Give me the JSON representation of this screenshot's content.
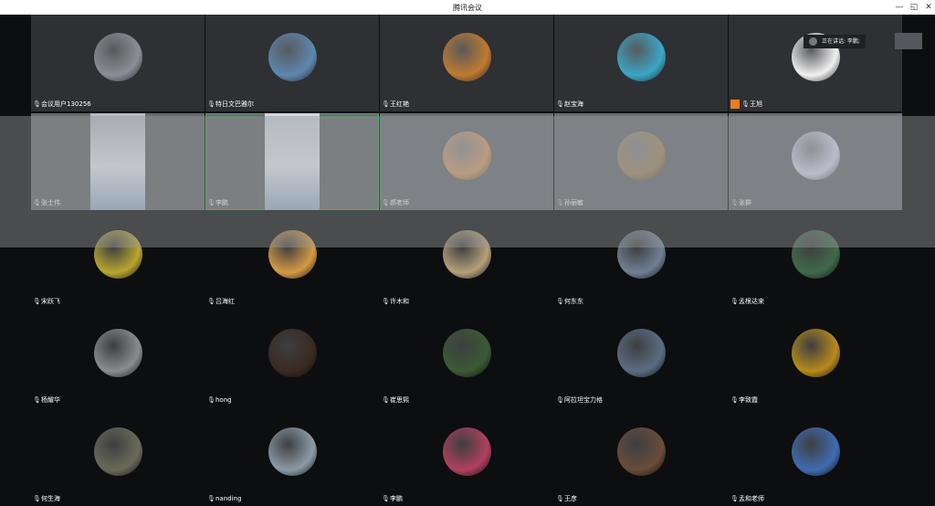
{
  "window": {
    "title": "腾讯会议",
    "minimize": "—",
    "restore": "◱",
    "close": "✕"
  },
  "speaking_indicator": {
    "label": "正在讲话: 李鹏;"
  },
  "participants": [
    {
      "name": "会议用户130256",
      "color": "#8a8f96",
      "mic": true
    },
    {
      "name": "特日文巴雅尔",
      "color": "#5d87ae",
      "mic": true
    },
    {
      "name": "王红艳",
      "color": "#c07a2e",
      "mic": true
    },
    {
      "name": "赵宝海",
      "color": "#3aa6c6",
      "mic": true
    },
    {
      "name": "王旭",
      "color": "#f0f0f0",
      "mic": true,
      "host": true
    },
    {
      "name": "张士伟",
      "color": "#b5b9c2",
      "mic": true,
      "video": true
    },
    {
      "name": "李鹏",
      "color": "#cfd6df",
      "mic": true,
      "video": true,
      "active": true
    },
    {
      "name": "郝老师",
      "color": "#d9a06c",
      "mic": true
    },
    {
      "name": "孙丽敏",
      "color": "#a58b64",
      "mic": false
    },
    {
      "name": "张群",
      "color": "#d7d8ef",
      "mic": false
    },
    {
      "name": "宋跃飞",
      "color": "#b8a531",
      "mic": true
    },
    {
      "name": "吕海红",
      "color": "#d49a44",
      "mic": true
    },
    {
      "name": "许木和",
      "color": "#b59f78",
      "mic": true
    },
    {
      "name": "何东东",
      "color": "#6f8094",
      "mic": true
    },
    {
      "name": "孟根达来",
      "color": "#3e6a4a",
      "mic": true
    },
    {
      "name": "杨耀华",
      "color": "#8a8c8e",
      "mic": true
    },
    {
      "name": "hong",
      "color": "#3a2a20",
      "mic": true
    },
    {
      "name": "崔思熙",
      "color": "#3b5a34",
      "mic": true
    },
    {
      "name": "阿拉坦宝力格",
      "color": "#5b6d84",
      "mic": true
    },
    {
      "name": "李致霞",
      "color": "#b78a1c",
      "mic": true
    },
    {
      "name": "何生海",
      "color": "#6a6a5a",
      "mic": true
    },
    {
      "name": "nanding",
      "color": "#8c9aa6",
      "mic": true
    },
    {
      "name": "李鹏",
      "color": "#b0405e",
      "mic": true
    },
    {
      "name": "王彦",
      "color": "#6a4c3a",
      "mic": true
    },
    {
      "name": "孟和老师",
      "color": "#3f6cb2",
      "mic": true
    }
  ]
}
